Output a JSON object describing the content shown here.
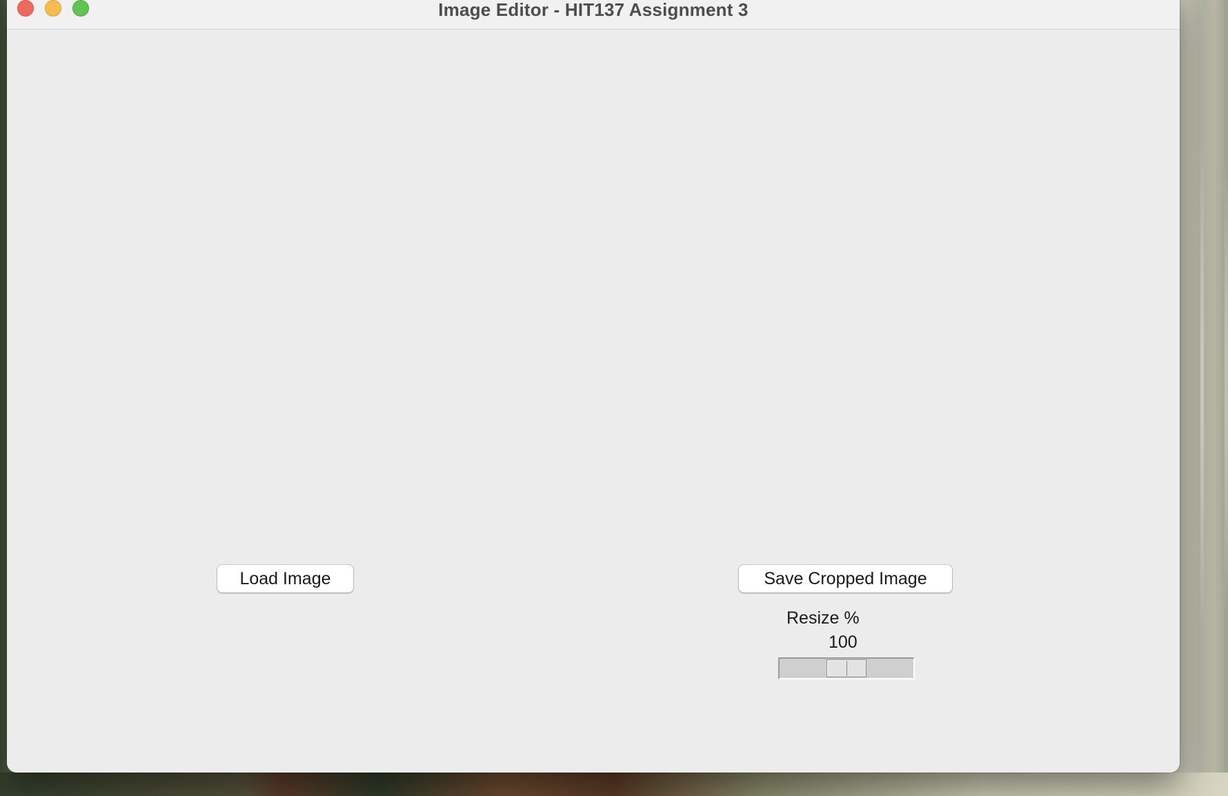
{
  "window": {
    "title": "Image Editor - HIT137 Assignment 3"
  },
  "buttons": {
    "load_image": "Load Image",
    "save_cropped_image": "Save Cropped Image"
  },
  "resize": {
    "label": "Resize %",
    "value": "100",
    "fraction": 0.5
  },
  "icons": {
    "close": "close-icon",
    "minimize": "minimize-icon",
    "maximize": "maximize-icon"
  },
  "colors": {
    "window_bg": "#ececec",
    "close": "#ee6a5f",
    "minimize": "#f5bd4f",
    "maximize": "#61c454"
  }
}
